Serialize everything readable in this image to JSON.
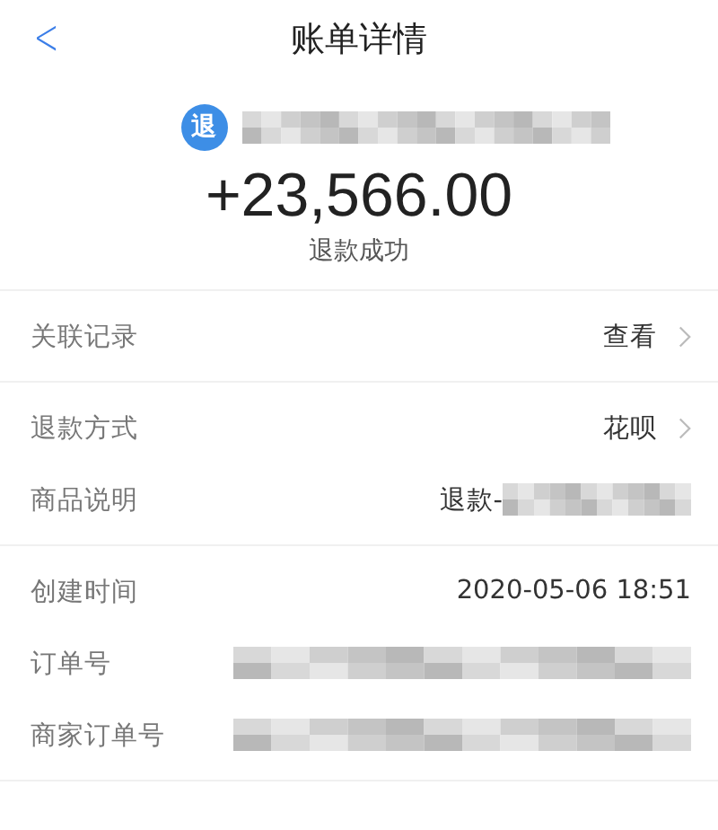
{
  "header": {
    "back": "<",
    "title": "账单详情"
  },
  "summary": {
    "badge": "退",
    "merchant_redacted": true,
    "amount": "+23,566.00",
    "status": "退款成功"
  },
  "sections": [
    [
      {
        "label": "关联记录",
        "value": "查看",
        "redacted": false,
        "link": true
      }
    ],
    [
      {
        "label": "退款方式",
        "value": "花呗",
        "redacted": false,
        "link": true
      },
      {
        "label": "商品说明",
        "value": "退款-",
        "redacted": true,
        "link": false
      }
    ],
    [
      {
        "label": "创建时间",
        "value": "2020-05-06 18:51",
        "redacted": false,
        "link": false
      },
      {
        "label": "订单号",
        "redacted": true,
        "link": false
      },
      {
        "label": "商家订单号",
        "redacted": true,
        "link": false
      }
    ]
  ]
}
